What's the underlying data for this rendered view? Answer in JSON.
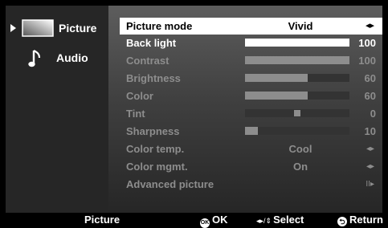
{
  "sidebar": {
    "items": [
      {
        "label": "Picture",
        "icon": "picture-icon",
        "selected": true
      },
      {
        "label": "Audio",
        "icon": "music-note-icon",
        "selected": false
      }
    ]
  },
  "menu": {
    "items": [
      {
        "label": "Picture mode",
        "value": "Vivid",
        "glyph": "◂▸"
      },
      {
        "label": "Back light",
        "value": 100,
        "level": 1.0
      },
      {
        "label": "Contrast",
        "value": 100,
        "level": 1.0
      },
      {
        "label": "Brightness",
        "value": 60,
        "level": 0.6
      },
      {
        "label": "Color",
        "value": 60,
        "level": 0.6
      },
      {
        "label": "Tint",
        "value": 0,
        "level": 0.5
      },
      {
        "label": "Sharpness",
        "value": 10,
        "level": 0.12
      },
      {
        "label": "Color temp.",
        "value": "Cool",
        "glyph": "◂▸"
      },
      {
        "label": "Color mgmt.",
        "value": "On",
        "glyph": "◂▸"
      },
      {
        "label": "Advanced picture",
        "glyph": "II▸"
      }
    ]
  },
  "footer": {
    "section": "Picture",
    "ok_button": "OK",
    "ok_icon": "OK",
    "select": "Select",
    "select_glyph": "◂▸/⇕",
    "return": "Return",
    "return_icon": "⮌"
  },
  "colors": {
    "selected_row_bg": "#ffffff",
    "active_text": "#ffffff",
    "dim_text": "#8d8d8d",
    "sidebar_bg": "#262626"
  }
}
